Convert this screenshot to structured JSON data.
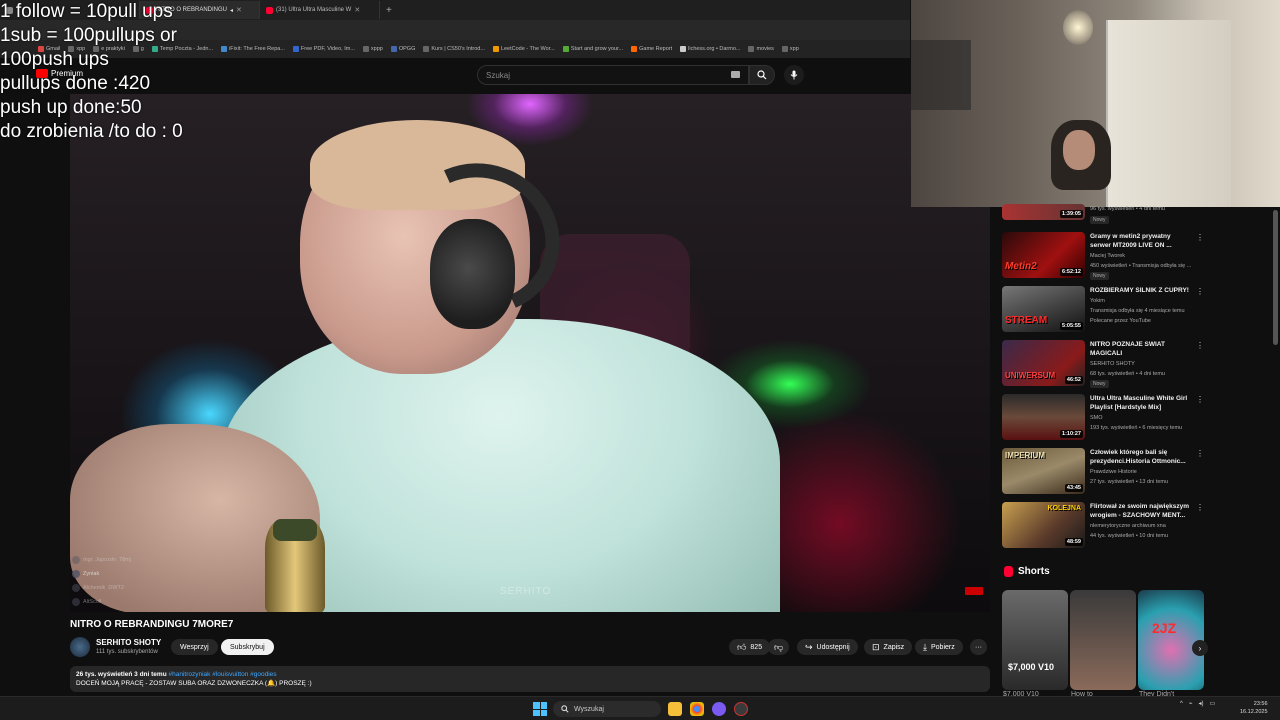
{
  "overlay": {
    "lines": [
      "1 follow = 10pull ups",
      "1sub = 100pullups or",
      "100push ups",
      "pullups done :420",
      "push up done:50",
      "do zrobienia /to do : 0"
    ]
  },
  "browser": {
    "tabs": [
      {
        "label": "NITRO O REBRANDINGU"
      },
      {
        "label": "(31) Ultra Ultra Masculine W"
      }
    ],
    "new_tab": "+",
    "bookmarks": [
      "Gmail",
      "xpp",
      "e praktyki",
      "g",
      "Temp Poczta - Jedn...",
      "iFixit: The Free Repa...",
      "Free PDF, Video, Im...",
      "xppp",
      "OPGG",
      "Kurs | CS50's Introd...",
      "LeetCode - The Wor...",
      "Start and grow your...",
      "Game Report",
      "lichess.org • Darmo...",
      "movies",
      "xpp"
    ]
  },
  "youtube": {
    "logo": "Premium",
    "search_placeholder": "Szukaj"
  },
  "video": {
    "title": "NITRO O REBRANDINGU 7MORE7",
    "watermark": "SERHITO",
    "chat": [
      {
        "user": "mgr. Japozdn",
        "msg": "78mj"
      },
      {
        "user": "Zyniak",
        "msg": ""
      },
      {
        "user": "Alchemik",
        "msg": "DWT2"
      },
      {
        "user": "AltScoll",
        "msg": ""
      }
    ],
    "channel": "SERHITO SHOTY",
    "subscribers": "111 tys. subskrybentów",
    "support_label": "Wesprzyj",
    "subscribe_label": "Subskrybuj",
    "likes": "825",
    "share_label": "Udostępnij",
    "save_label": "Zapisz",
    "download_label": "Pobierz",
    "more_label": "···",
    "views_date": "26 tys. wyświetleń  3 dni temu",
    "tags": "#hanitrozyniak #louisvuitton #goodies",
    "description": "DOCEŃ MOJĄ PRACĘ - ZOSTAW SUBA ORAZ DZWONECZKA (🔔) PROSZĘ :)"
  },
  "sidebar": {
    "items": [
      {
        "title": "",
        "channel": "",
        "meta": "96 tys. wyświetleń • 4 dni temu",
        "badge": "Nowy",
        "duration": "1:39:05",
        "thumb_label": ""
      },
      {
        "title": "Gramy w metin2 prywatny serwer MT2009 LIVE ON ...",
        "channel": "Maciej Tworek",
        "meta": "450 wyświetleń • Transmisja odbyła się ...",
        "badge": "Nowy",
        "duration": "6:52:12",
        "thumb_label": "Metin2"
      },
      {
        "title": "ROZBIERAMY SILNIK Z CUPRY!",
        "channel": "Yokim",
        "meta": "Transmisja odbyła się 4 miesiące temu",
        "badge": "Polecane przez YouTube",
        "duration": "5:05:55",
        "thumb_label": "STREAM"
      },
      {
        "title": "NITRO POZNAJE ŚWIAT MAGICALI",
        "channel": "SERHITO SHOTY",
        "meta": "68 tys. wyświetleń • 4 dni temu",
        "badge": "Nowy",
        "duration": "46:52",
        "thumb_label": "UNIWERSUM"
      },
      {
        "title": "Ultra Ultra Masculine White Girl Playlist [Hardstyle Mix]",
        "channel": "SMO",
        "meta": "193 tys. wyświetleń • 6 miesięcy temu",
        "badge": "",
        "duration": "1:10:27",
        "thumb_label": ""
      },
      {
        "title": "Człowiek którego bali się prezydenci.Historia Ottmonic...",
        "channel": "Prawdziwe Historie",
        "meta": "27 tys. wyświetleń • 13 dni temu",
        "badge": "",
        "duration": "43:45",
        "thumb_label": "IMPERIUM"
      },
      {
        "title": "Flirtował ze swoim największym wrogiem - SZACHOWY MENT...",
        "channel": "nlemerytoryczne archiwum xna",
        "meta": "44 tys. wyświetleń • 10 dni temu",
        "badge": "",
        "duration": "48:59",
        "thumb_label": "KOLEJNA"
      }
    ],
    "shorts_label": "Shorts",
    "shorts": [
      {
        "overlay": "$7,000 V10",
        "caption": "$7,000 V10"
      },
      {
        "overlay": "",
        "caption": "How to"
      },
      {
        "overlay": "2JZ",
        "caption": "They Didn't"
      }
    ]
  },
  "taskbar": {
    "search": "Wyszukaj",
    "time": "23:56",
    "date": "16.12.2025"
  },
  "colors": {
    "bg": "#0f0f0f",
    "accent": "#ff0033",
    "link": "#3ea6ff"
  }
}
